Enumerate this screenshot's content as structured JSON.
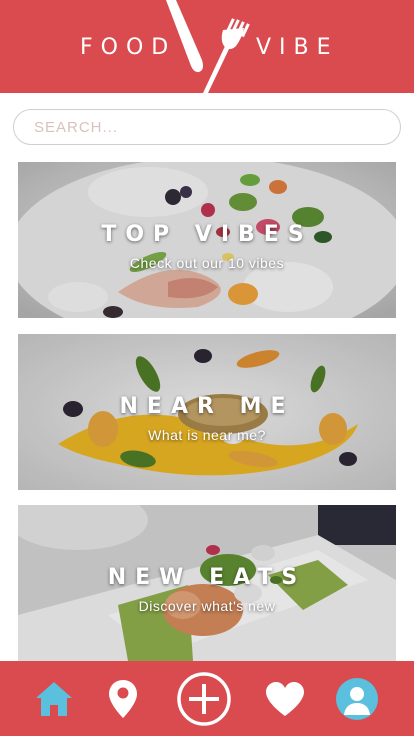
{
  "header": {
    "brand_left": "FOOD",
    "brand_right": "VIBE",
    "logo_icon": "fork-knife-icon"
  },
  "search": {
    "placeholder": "SEARCH...",
    "value": ""
  },
  "cards": [
    {
      "title": "TOP VIBES",
      "subtitle": "Check out our 10 vibes"
    },
    {
      "title": "NEAR ME",
      "subtitle": "What is near me?"
    },
    {
      "title": "NEW EATS",
      "subtitle": "Discover what's new"
    }
  ],
  "nav": {
    "items": [
      {
        "icon": "home-icon",
        "active": true
      },
      {
        "icon": "map-pin-icon",
        "active": false
      },
      {
        "icon": "plus-circle-icon",
        "active": false
      },
      {
        "icon": "heart-icon",
        "active": false
      },
      {
        "icon": "user-avatar-icon",
        "active": false
      }
    ]
  },
  "colors": {
    "brand": "#d94b4f",
    "accent": "#5bc0de",
    "white": "#ffffff",
    "placeholder": "#d7c2bd"
  }
}
